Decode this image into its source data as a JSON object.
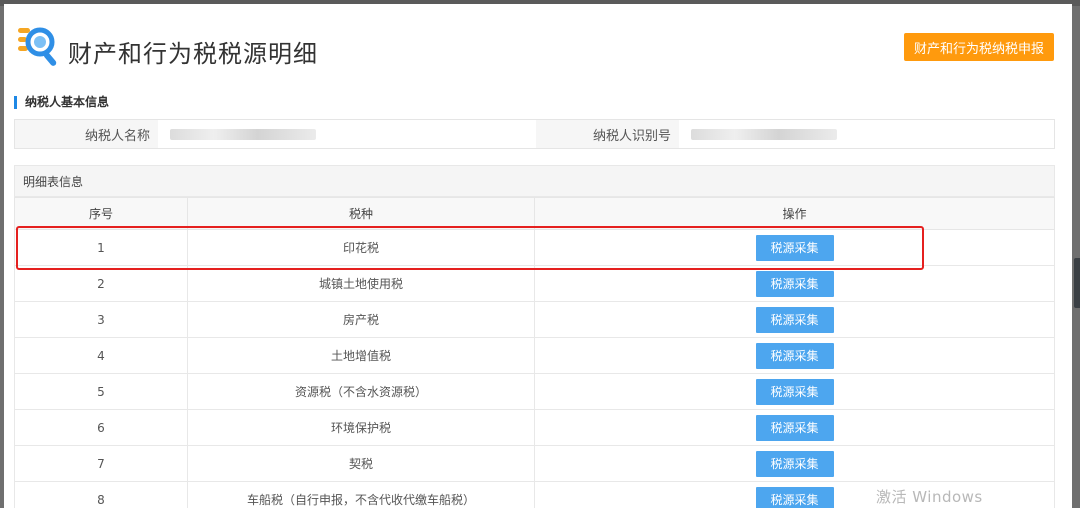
{
  "header": {
    "title": "财产和行为税税源明细",
    "declare_button": "财产和行为税纳税申报",
    "logo_icon": "search-document-icon"
  },
  "taxpayer": {
    "section_title": "纳税人基本信息",
    "name_label": "纳税人名称",
    "id_label": "纳税人识别号"
  },
  "detail": {
    "section_title": "明细表信息",
    "columns": [
      "序号",
      "税种",
      "操作"
    ],
    "rows": [
      {
        "no": "1",
        "tax": "印花税",
        "action": "税源采集"
      },
      {
        "no": "2",
        "tax": "城镇土地使用税",
        "action": "税源采集"
      },
      {
        "no": "3",
        "tax": "房产税",
        "action": "税源采集"
      },
      {
        "no": "4",
        "tax": "土地增值税",
        "action": "税源采集"
      },
      {
        "no": "5",
        "tax": "资源税（不含水资源税）",
        "action": "税源采集"
      },
      {
        "no": "6",
        "tax": "环境保护税",
        "action": "税源采集"
      },
      {
        "no": "7",
        "tax": "契税",
        "action": "税源采集"
      },
      {
        "no": "8",
        "tax": "车船税（自行申报，不含代收代缴车船税）",
        "action": "税源采集"
      }
    ]
  },
  "watermark": "激活 Windows",
  "colors": {
    "accent": "#ff9a0d",
    "button": "#4da6ef",
    "highlight": "#e5201f",
    "section_bar": "#1e88e5"
  }
}
